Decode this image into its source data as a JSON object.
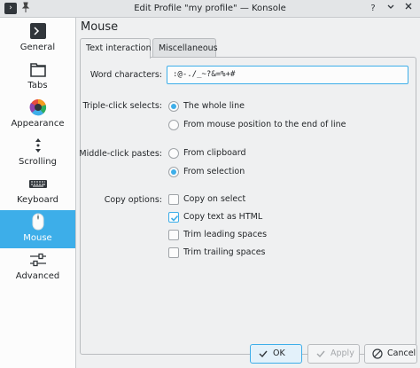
{
  "window": {
    "title": "Edit Profile \"my profile\" — Konsole"
  },
  "sidebar": {
    "items": [
      {
        "label": "General",
        "icon": "terminal-icon"
      },
      {
        "label": "Tabs",
        "icon": "tabs-icon"
      },
      {
        "label": "Appearance",
        "icon": "color-wheel-icon"
      },
      {
        "label": "Scrolling",
        "icon": "scroll-icon"
      },
      {
        "label": "Keyboard",
        "icon": "keyboard-icon"
      },
      {
        "label": "Mouse",
        "icon": "mouse-icon",
        "selected": true
      },
      {
        "label": "Advanced",
        "icon": "advanced-icon"
      }
    ]
  },
  "page": {
    "title": "Mouse",
    "tabs": [
      "Text interaction",
      "Miscellaneous"
    ],
    "active_tab": "Text interaction"
  },
  "form": {
    "word_characters_label": "Word characters:",
    "word_characters_value": ":@-./_~?&=%+#",
    "triple_click_label": "Triple-click selects:",
    "triple_click_options": [
      {
        "label": "The whole line",
        "selected": true
      },
      {
        "label": "From mouse position to the end of line",
        "selected": false
      }
    ],
    "middle_click_label": "Middle-click pastes:",
    "middle_click_options": [
      {
        "label": "From clipboard",
        "selected": false
      },
      {
        "label": "From selection",
        "selected": true
      }
    ],
    "copy_options_label": "Copy options:",
    "copy_options": [
      {
        "label": "Copy on select",
        "checked": false
      },
      {
        "label": "Copy text as HTML",
        "checked": true
      },
      {
        "label": "Trim leading spaces",
        "checked": false
      },
      {
        "label": "Trim trailing spaces",
        "checked": false
      }
    ]
  },
  "buttons": {
    "ok": "OK",
    "apply": "Apply",
    "cancel": "Cancel"
  },
  "colors": {
    "accent": "#3daee9",
    "window_bg": "#eff0f1",
    "text": "#232629"
  }
}
